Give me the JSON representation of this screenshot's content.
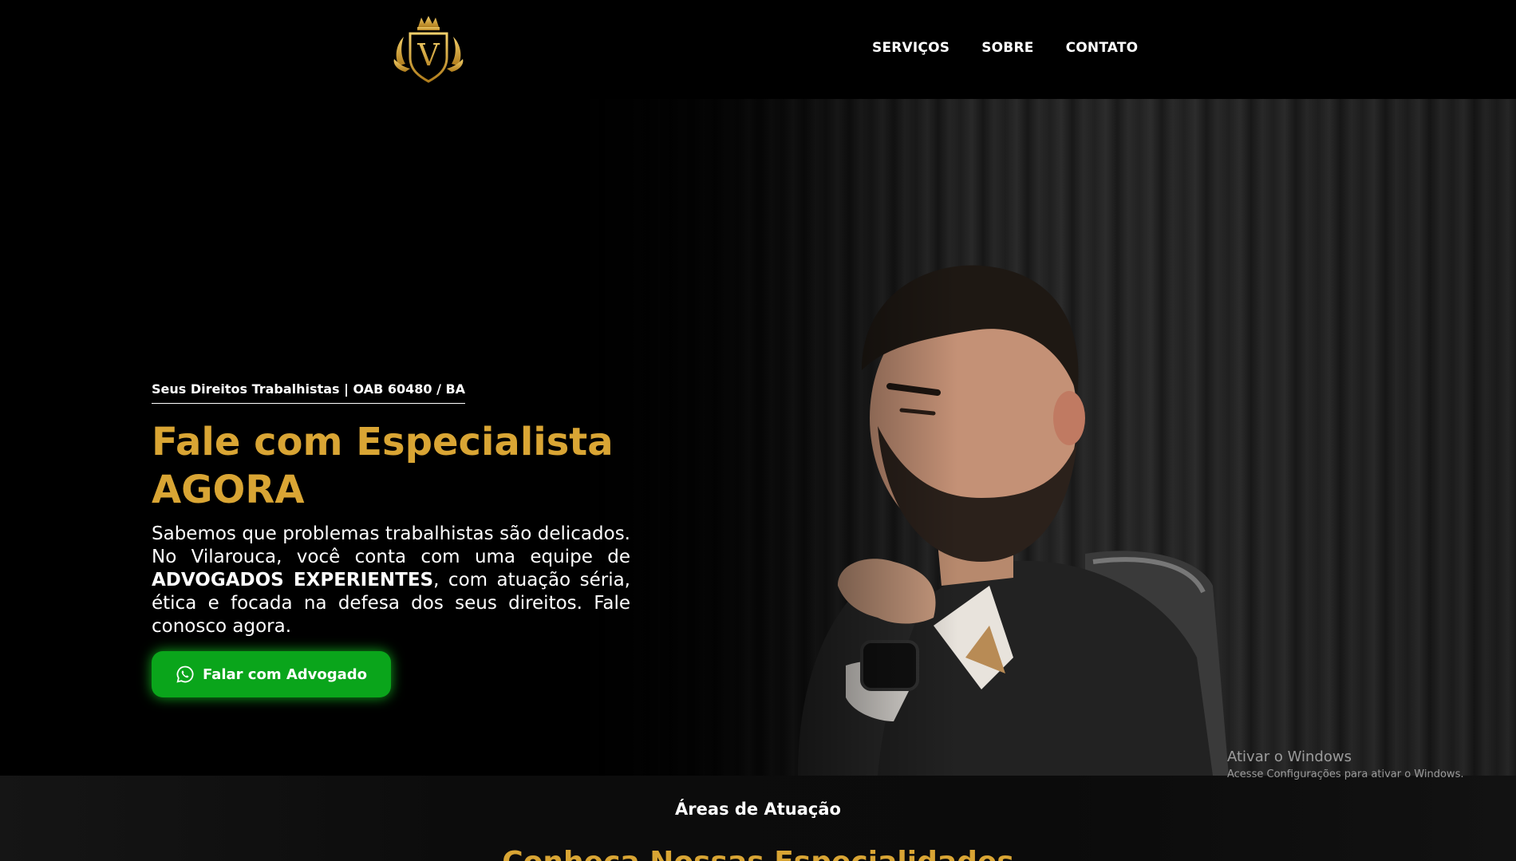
{
  "brand": {
    "logo_letter": "V",
    "gold": "#d9a534"
  },
  "nav": {
    "items": [
      "SERVIÇOS",
      "SOBRE",
      "CONTATO"
    ]
  },
  "hero": {
    "eyebrow": "Seus Direitos Trabalhistas | OAB 60480 / BA",
    "title": "Fale com Especialista AGORA",
    "desc_part1": "Sabemos que problemas trabalhistas são delicados. No Vilarouca, você conta com uma equipe de ",
    "desc_bold": "ADVOGADOS EXPERIENTES",
    "desc_part2": ", com atuação séria, ética e focada na defesa dos seus direitos. Fale conosco agora.",
    "cta_label": "Falar com Advogado",
    "cta_icon": "whatsapp-icon",
    "cta_color": "#0aa51b"
  },
  "areas": {
    "label": "Áreas de Atuação",
    "heading": "Conheça Nossas Especialidades"
  },
  "system_watermark": {
    "line1": "Ativar o Windows",
    "line2": "Acesse Configurações para ativar o Windows."
  }
}
